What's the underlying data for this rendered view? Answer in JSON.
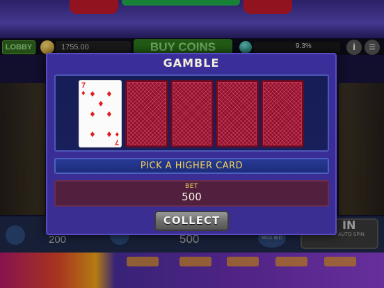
{
  "header": {
    "lobby_label": "LOBBY",
    "balance": "1755.00",
    "buy_coins_label": "BUY COINS",
    "level_percent": "9.3%",
    "info_label": "i",
    "menu_label": "☰"
  },
  "bottom_bar": {
    "bet_amount": "200",
    "total_bet": "500",
    "max_bid_label": "MAX BID",
    "spin_label": "IN",
    "auto_spin_label": "AUTO SPIN"
  },
  "gamble": {
    "title": "GAMBLE",
    "dealer_card": {
      "rank": "7",
      "suit": "diamonds",
      "suit_symbol": "♦",
      "color": "#e11b1b"
    },
    "face_down_cards": 4,
    "instruction": "PICK A HIGHER CARD",
    "bet_label": "BET",
    "bet_value": "500",
    "collect_label": "COLLECT"
  },
  "colors": {
    "modal_bg": "#3a2e9a",
    "cards_panel_bg": "#171d56",
    "instruction_text": "#f2d35a",
    "bet_box_bg": "#51203e",
    "card_back": "#8e0f2b"
  }
}
